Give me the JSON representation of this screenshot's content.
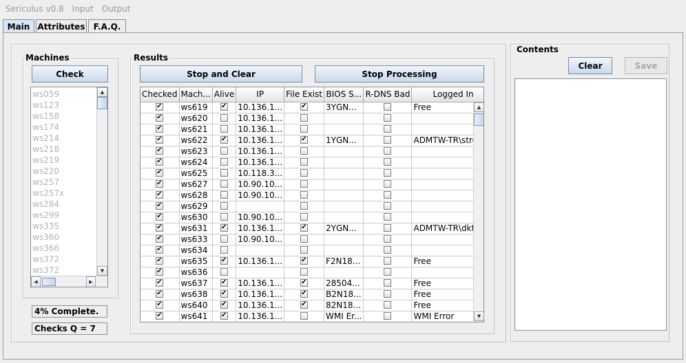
{
  "app": {
    "title": "Sericulus v0.8"
  },
  "menu": [
    "Input",
    "Output"
  ],
  "tabs": [
    "Main",
    "Attributes",
    "F.A.Q."
  ],
  "machines": {
    "title": "Machines",
    "check_label": "Check",
    "items": [
      "ws059",
      "ws123",
      "ws158",
      "ws174",
      "ws214",
      "ws218",
      "ws219",
      "ws220",
      "ws257",
      "ws257x",
      "ws284",
      "ws299",
      "ws335",
      "ws360",
      "ws366",
      "ws372",
      "ws372"
    ],
    "status": "4% Complete.",
    "queue": "Checks Q = 7"
  },
  "results": {
    "title": "Results",
    "stop_clear_label": "Stop and Clear",
    "stop_processing_label": "Stop Processing",
    "columns": [
      "Checked",
      "Mach...",
      "Alive",
      "IP",
      "File Exist",
      "BIOS S...",
      "R-DNS Bad",
      "Logged In"
    ],
    "rows": [
      {
        "checked": true,
        "machine": "ws619",
        "alive": true,
        "ip": "10.136.1...",
        "file_exist": true,
        "bios": "3YGN...",
        "rdns_bad": false,
        "logged_in": "Free"
      },
      {
        "checked": true,
        "machine": "ws620",
        "alive": false,
        "ip": "10.136.1...",
        "file_exist": false,
        "bios": "",
        "rdns_bad": false,
        "logged_in": ""
      },
      {
        "checked": true,
        "machine": "ws621",
        "alive": false,
        "ip": "10.136.1...",
        "file_exist": false,
        "bios": "",
        "rdns_bad": false,
        "logged_in": ""
      },
      {
        "checked": true,
        "machine": "ws622",
        "alive": true,
        "ip": "10.136.1...",
        "file_exist": true,
        "bios": "1YGN...",
        "rdns_bad": false,
        "logged_in": "ADMTW-TR\\stroll..."
      },
      {
        "checked": true,
        "machine": "ws623",
        "alive": false,
        "ip": "10.136.1...",
        "file_exist": false,
        "bios": "",
        "rdns_bad": false,
        "logged_in": ""
      },
      {
        "checked": true,
        "machine": "ws624",
        "alive": false,
        "ip": "10.136.1...",
        "file_exist": false,
        "bios": "",
        "rdns_bad": false,
        "logged_in": ""
      },
      {
        "checked": true,
        "machine": "ws625",
        "alive": false,
        "ip": "10.118.3...",
        "file_exist": false,
        "bios": "",
        "rdns_bad": false,
        "logged_in": ""
      },
      {
        "checked": true,
        "machine": "ws627",
        "alive": false,
        "ip": "10.90.10...",
        "file_exist": false,
        "bios": "",
        "rdns_bad": false,
        "logged_in": ""
      },
      {
        "checked": true,
        "machine": "ws628",
        "alive": false,
        "ip": "10.90.10...",
        "file_exist": false,
        "bios": "",
        "rdns_bad": false,
        "logged_in": ""
      },
      {
        "checked": true,
        "machine": "ws629",
        "alive": false,
        "ip": "",
        "file_exist": false,
        "bios": "",
        "rdns_bad": false,
        "logged_in": ""
      },
      {
        "checked": true,
        "machine": "ws630",
        "alive": false,
        "ip": "10.90.10...",
        "file_exist": false,
        "bios": "",
        "rdns_bad": false,
        "logged_in": ""
      },
      {
        "checked": true,
        "machine": "ws631",
        "alive": true,
        "ip": "10.136.1...",
        "file_exist": true,
        "bios": "2YGN...",
        "rdns_bad": false,
        "logged_in": "ADMTW-TR\\dkten..."
      },
      {
        "checked": true,
        "machine": "ws633",
        "alive": false,
        "ip": "10.90.10...",
        "file_exist": false,
        "bios": "",
        "rdns_bad": false,
        "logged_in": ""
      },
      {
        "checked": true,
        "machine": "ws634",
        "alive": false,
        "ip": "",
        "file_exist": false,
        "bios": "",
        "rdns_bad": false,
        "logged_in": ""
      },
      {
        "checked": true,
        "machine": "ws635",
        "alive": true,
        "ip": "10.136.1...",
        "file_exist": true,
        "bios": "F2N18...",
        "rdns_bad": false,
        "logged_in": "Free"
      },
      {
        "checked": true,
        "machine": "ws636",
        "alive": false,
        "ip": "",
        "file_exist": false,
        "bios": "",
        "rdns_bad": false,
        "logged_in": ""
      },
      {
        "checked": true,
        "machine": "ws637",
        "alive": true,
        "ip": "10.136.1...",
        "file_exist": true,
        "bios": "28504...",
        "rdns_bad": false,
        "logged_in": "Free"
      },
      {
        "checked": true,
        "machine": "ws638",
        "alive": true,
        "ip": "10.136.1...",
        "file_exist": true,
        "bios": "B2N18...",
        "rdns_bad": false,
        "logged_in": "Free"
      },
      {
        "checked": true,
        "machine": "ws640",
        "alive": true,
        "ip": "10.136.1...",
        "file_exist": true,
        "bios": "82N18...",
        "rdns_bad": false,
        "logged_in": "Free"
      },
      {
        "checked": true,
        "machine": "ws641",
        "alive": true,
        "ip": "10.136.1...",
        "file_exist": false,
        "bios": "WMI Er...",
        "rdns_bad": false,
        "logged_in": "WMI Error"
      }
    ]
  },
  "contents": {
    "title": "Contents",
    "clear_label": "Clear",
    "save_label": "Save"
  },
  "icons": {
    "scroll_up": "arrow-up-icon",
    "scroll_down": "arrow-down-icon",
    "scroll_left": "arrow-left-icon",
    "scroll_right": "arrow-right-icon"
  }
}
